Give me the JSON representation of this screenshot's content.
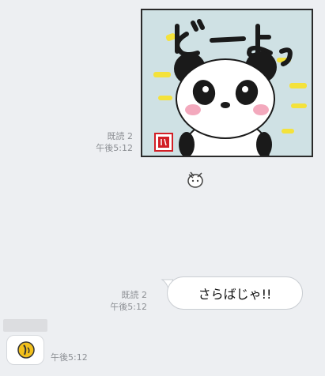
{
  "messages": {
    "sticker_message": {
      "read_label": "既読 2",
      "time": "午後5:12",
      "sticker_text": "ど̅ーよっ",
      "seal_text": "はっ"
    },
    "text_message": {
      "read_label": "既読 2",
      "time": "午後5:12",
      "text": "さらばじゃ!!"
    },
    "incoming_message": {
      "time": "午後5:12"
    }
  },
  "colors": {
    "background": "#edeff2",
    "sticker_bg": "#cfe1e4",
    "accent_yellow": "#f4e23b",
    "meta_text": "#8c8f94"
  }
}
